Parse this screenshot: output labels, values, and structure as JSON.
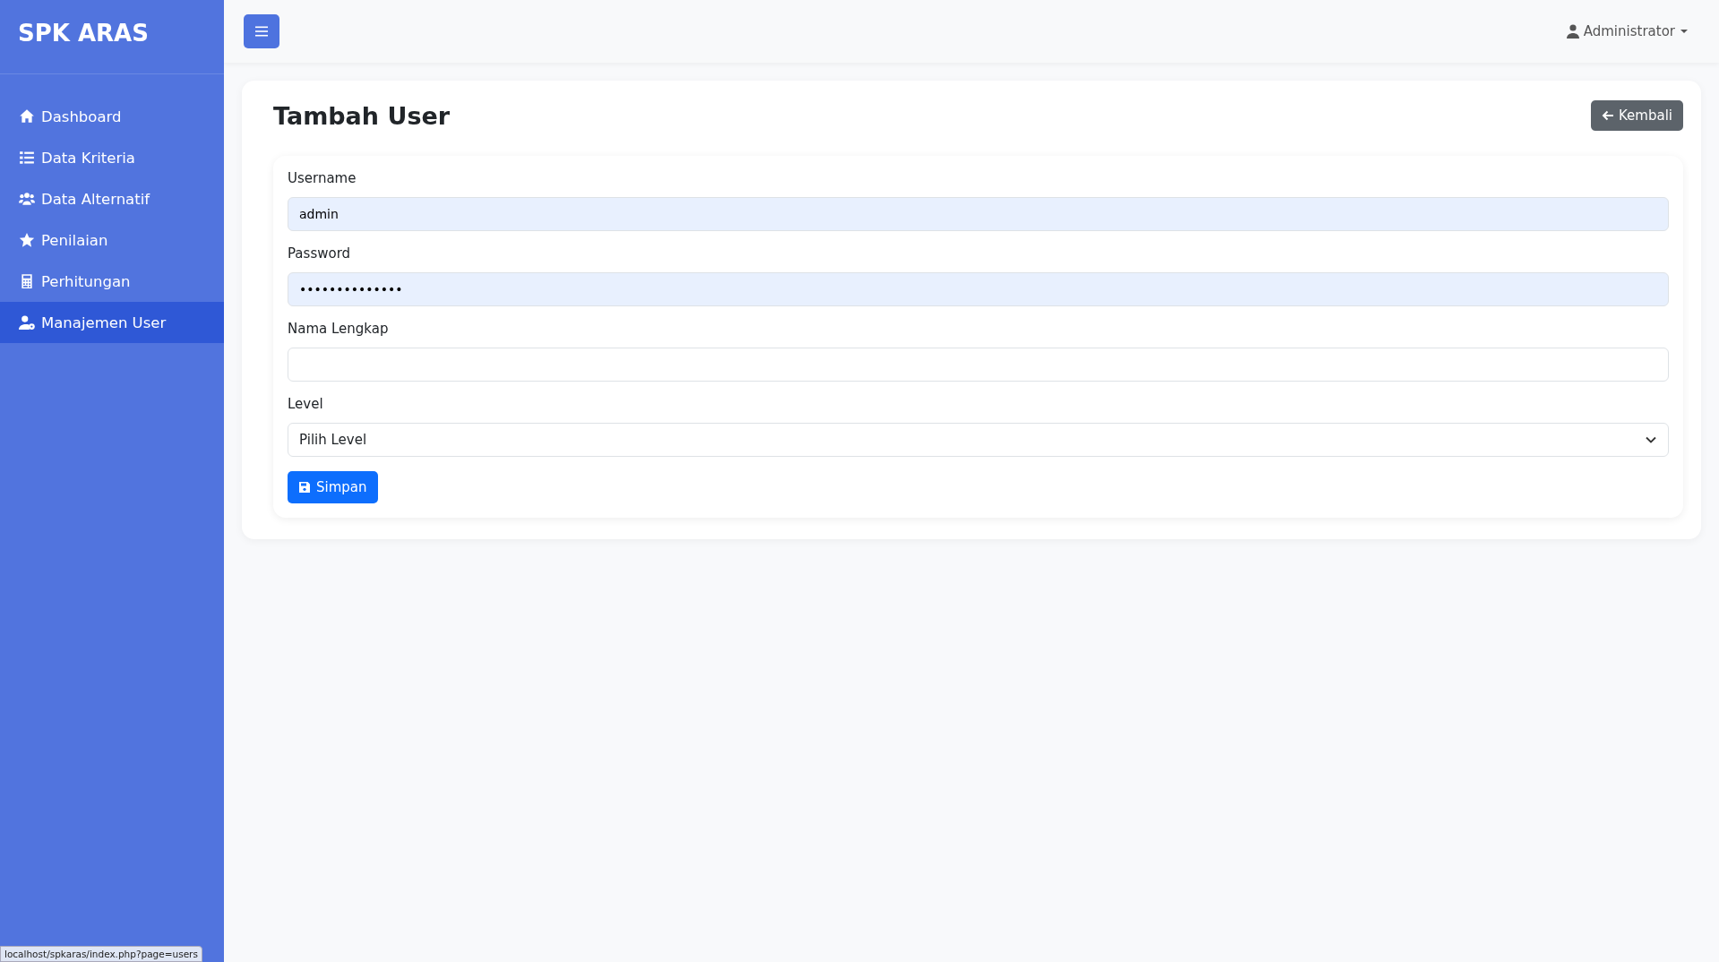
{
  "sidebar": {
    "brand": "SPK ARAS",
    "items": [
      {
        "label": "Dashboard",
        "selected": false
      },
      {
        "label": "Data Kriteria",
        "selected": false
      },
      {
        "label": "Data Alternatif",
        "selected": false
      },
      {
        "label": "Penilaian",
        "selected": false
      },
      {
        "label": "Perhitungan",
        "selected": false
      },
      {
        "label": "Manajemen User",
        "selected": true
      }
    ]
  },
  "topbar": {
    "user": "Administrator"
  },
  "page": {
    "title": "Tambah User",
    "back_button": "Kembali"
  },
  "form": {
    "fields": [
      {
        "kind": "text",
        "label": "Username",
        "value": "admin",
        "autofilled": true
      },
      {
        "kind": "text",
        "label": "Password",
        "value": "••••••••••••••",
        "autofilled": true
      },
      {
        "kind": "text",
        "label": "Nama Lengkap",
        "autofilled": false
      },
      {
        "kind": "select",
        "label": "Level",
        "value": "Pilih Level",
        "autofilled": false
      }
    ],
    "submit": "Simpan"
  },
  "status_bar": "localhost/spkaras/index.php?page=users"
}
